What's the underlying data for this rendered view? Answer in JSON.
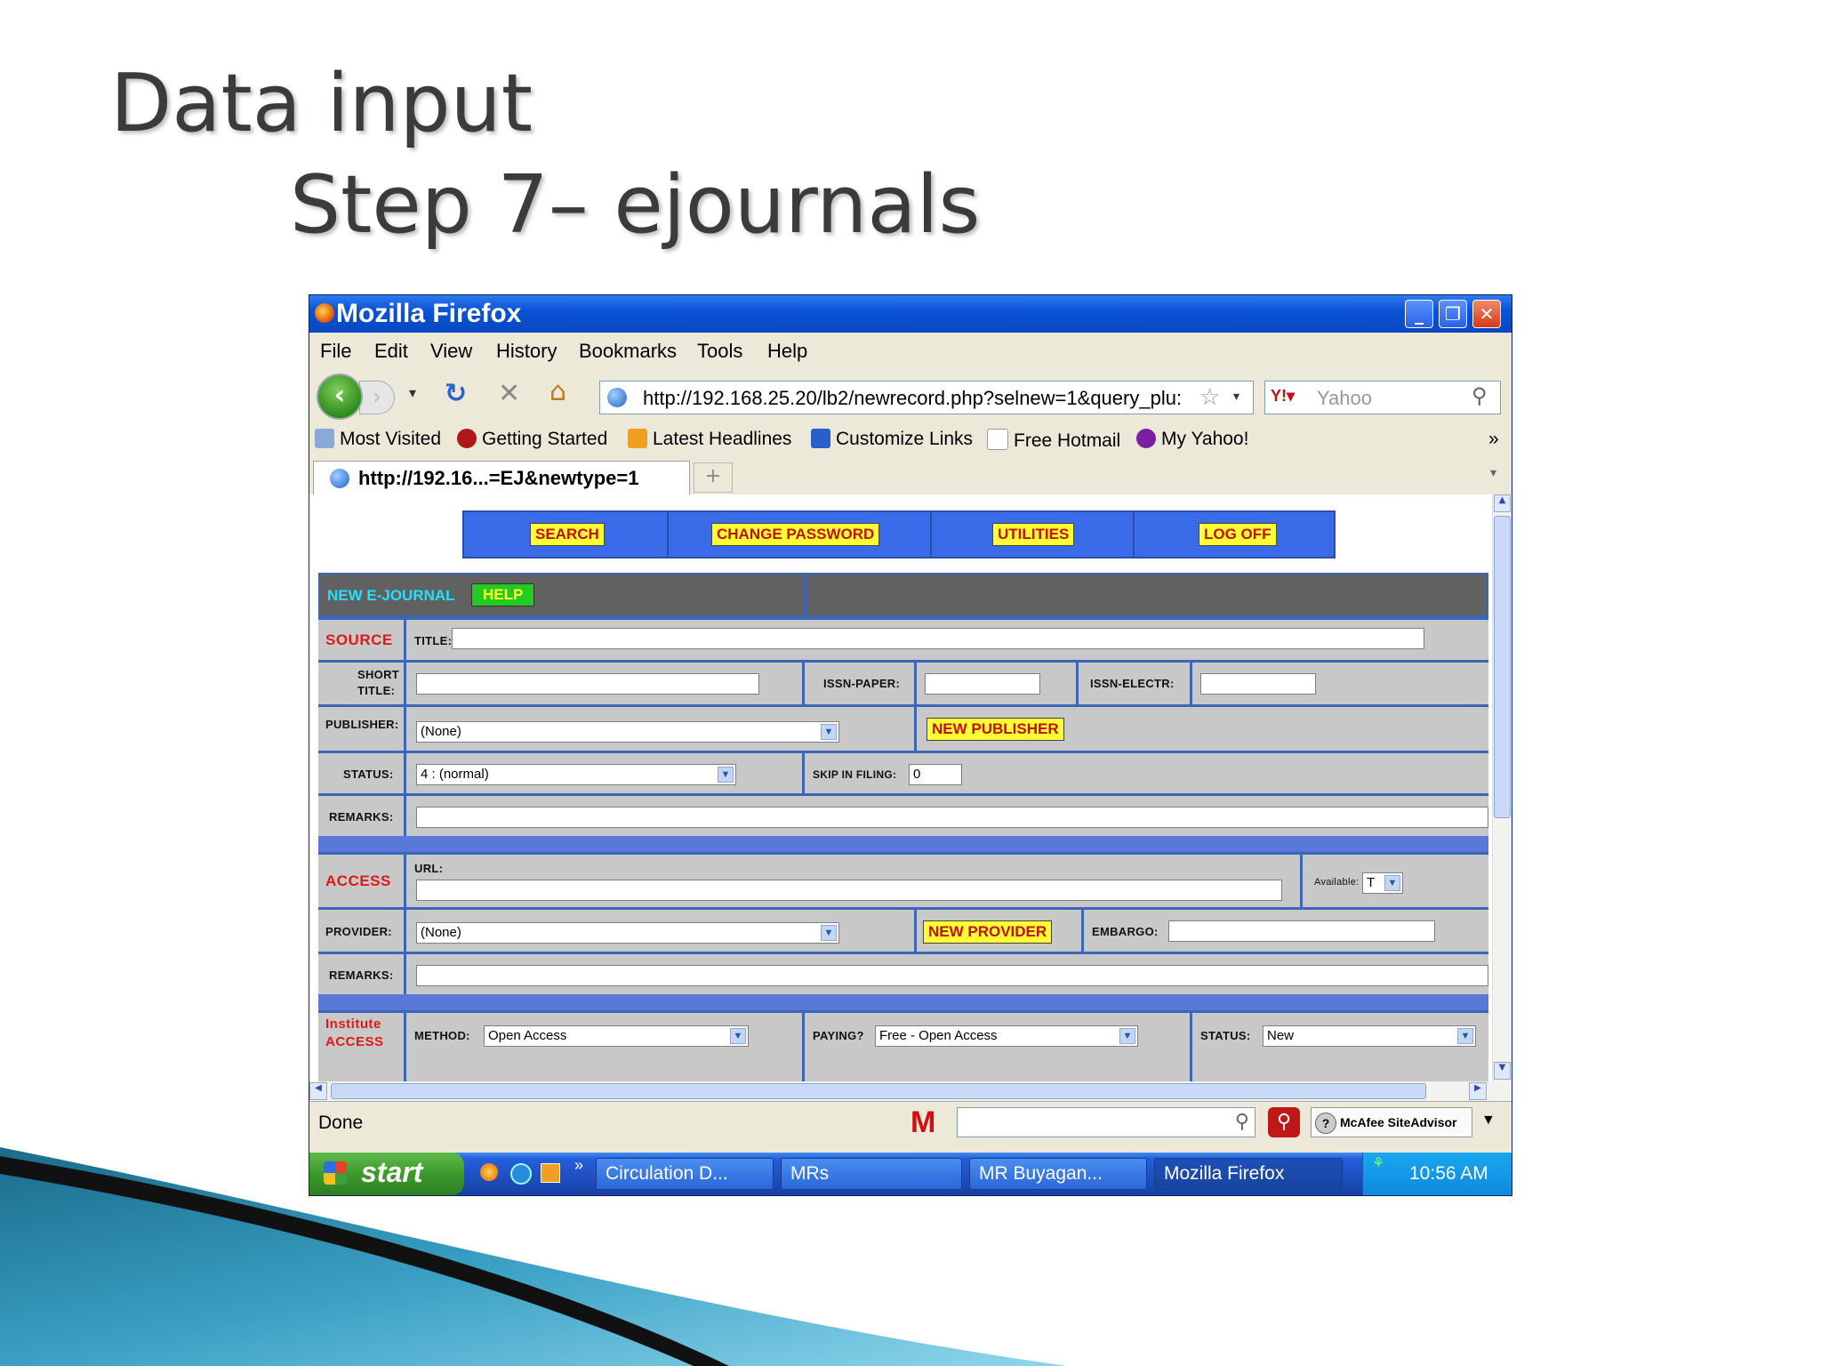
{
  "slide": {
    "title": "Data input",
    "subtitle": "Step 7– ejournals"
  },
  "window": {
    "title": "Mozilla Firefox",
    "minimize": "_",
    "restore": "❐",
    "close": "✕"
  },
  "menu": [
    "File",
    "Edit",
    "View",
    "History",
    "Bookmarks",
    "Tools",
    "Help"
  ],
  "nav": {
    "url": "http://192.168.25.20/lb2/newrecord.php?selnew=1&query_plu:",
    "search_placeholder": "Yahoo",
    "icons": {
      "back": "back-arrow-icon",
      "forward": "forward-arrow-icon",
      "reload": "reload-icon",
      "stop": "stop-icon",
      "home": "home-icon"
    }
  },
  "bookmarks": [
    "Most Visited",
    "Getting Started",
    "Latest Headlines",
    "Customize Links",
    "Free Hotmail",
    "My Yahoo!"
  ],
  "bookmarks_more": "»",
  "tab": {
    "label": "http://192.16...=EJ&newtype=1",
    "new_tab": "+"
  },
  "topnav": [
    "SEARCH",
    "CHANGE PASSWORD",
    "UTILITIES",
    "LOG OFF"
  ],
  "form": {
    "header": "NEW E-JOURNAL",
    "help": "HELP",
    "source": "SOURCE",
    "title_label": "TITLE:",
    "short_title_label_1": "SHORT",
    "short_title_label_2": "TITLE:",
    "issn_paper_label": "ISSN-PAPER:",
    "issn_electr_label": "ISSN-ELECTR:",
    "publisher_label": "PUBLISHER:",
    "publisher_value": "(None)",
    "new_publisher": "NEW PUBLISHER",
    "status_label": "STATUS:",
    "status_value": "4 : (normal)",
    "skip_label": "SKIP IN FILING:",
    "skip_value": "0",
    "remarks_label": "REMARKS:",
    "access": "ACCESS",
    "url_label": "URL:",
    "available_label": "Available:",
    "available_value": "T",
    "provider_label": "PROVIDER:",
    "provider_value": "(None)",
    "new_provider": "NEW PROVIDER",
    "embargo_label": "EMBARGO:",
    "remarks2_label": "REMARKS:",
    "institute_1": "Institute",
    "institute_2": "ACCESS",
    "method_label": "METHOD:",
    "method_value": "Open Access",
    "paying_label": "PAYING?",
    "paying_value": "Free - Open Access",
    "status2_label": "STATUS:",
    "status2_value": "New"
  },
  "statusbar": {
    "text": "Done",
    "mcafee": "McAfee SiteAdvisor"
  },
  "taskbar": {
    "start": "start",
    "tasks": [
      "Circulation D...",
      "MRs",
      "MR Buyagan...",
      "Mozilla Firefox"
    ],
    "clock": "10:56 AM"
  },
  "colors": {
    "titlebar": "#0a53d6",
    "form_bg": "#c8c8c8",
    "button_yellow": "#ffff33",
    "label_red": "#e01818",
    "help_green": "#22cc22"
  }
}
